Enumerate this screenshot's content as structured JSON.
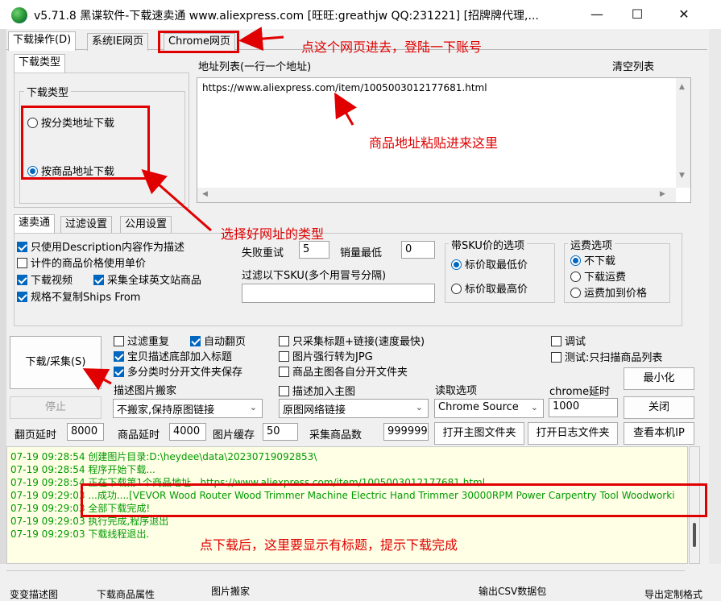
{
  "window": {
    "title": "v5.71.8  黑谍软件-下载速卖通  www.aliexpress.com [旺旺:greathjw QQ:231221] [招牌牌代理,..."
  },
  "tabs": [
    "下载操作(D)",
    "系统IE网页",
    "Chrome网页"
  ],
  "download_type": {
    "tab": "下载类型",
    "group_title": "下载类型",
    "options": [
      "按分类地址下载",
      "按商品地址下载"
    ],
    "selected": 1
  },
  "address": {
    "label": "地址列表(一行一个地址)",
    "clear_label": "清空列表",
    "value": "https://www.aliexpress.com/item/1005003012177681.html"
  },
  "settings_tabs": [
    "速卖通",
    "过滤设置",
    "公用设置"
  ],
  "checkboxes_left": [
    {
      "label": "只使用Description内容作为描述",
      "checked": true
    },
    {
      "label": "计件的商品价格使用单价",
      "checked": false
    },
    {
      "label": "下载视频",
      "checked": true
    },
    {
      "label": "采集全球英文站商品",
      "checked": true
    },
    {
      "label": "规格不复制Ships From",
      "checked": true
    }
  ],
  "retry": {
    "label": "失败重试",
    "value": "5"
  },
  "min_sales": {
    "label": "销量最低",
    "value": "0"
  },
  "sku_filter": {
    "label": "过滤以下SKU(多个用冒号分隔)",
    "value": ""
  },
  "sku_price": {
    "title": "带SKU价的选项",
    "options": [
      "标价取最低价",
      "标价取最高价"
    ],
    "selected": 0
  },
  "shipping": {
    "title": "运费选项",
    "options": [
      "不下载",
      "下载运费",
      "运费加到价格"
    ],
    "selected": 0
  },
  "actions": {
    "download": "下载/采集(S)",
    "stop": "停止",
    "minimize": "最小化",
    "close": "关闭",
    "open_main_folder": "打开主图文件夹",
    "open_log_folder": "打开日志文件夹",
    "check_ip": "查看本机IP"
  },
  "options_mid": [
    {
      "label": "过滤重复",
      "checked": false
    },
    {
      "label": "自动翻页",
      "checked": true
    },
    {
      "label": "宝贝描述底部加入标题",
      "checked": true
    },
    {
      "label": "多分类时分开文件夹保存",
      "checked": true
    },
    {
      "label": "描述加入主图",
      "checked": false
    }
  ],
  "options_right": [
    {
      "label": "只采集标题+链接(速度最快)",
      "checked": false
    },
    {
      "label": "图片强行转为JPG",
      "checked": false
    },
    {
      "label": "商品主图各自分开文件夹",
      "checked": false
    }
  ],
  "options_far": [
    {
      "label": "调试",
      "checked": false
    },
    {
      "label": "测试:只扫描商品列表",
      "checked": false
    }
  ],
  "desc_image": {
    "label": "描述图片搬家",
    "value": "不搬家,保持原图链接"
  },
  "main_image": {
    "value": "原图网络链接"
  },
  "read_option": {
    "label": "读取选项",
    "value": "Chrome Source"
  },
  "chrome_delay": {
    "label": "chrome延时",
    "value": "1000"
  },
  "delays": {
    "page_label": "翻页延时",
    "page_value": "8000",
    "item_label": "商品延时",
    "item_value": "4000",
    "cache_label": "图片缓存",
    "cache_value": "50",
    "count_label": "采集商品数",
    "count_value": "999999"
  },
  "log": [
    "07-19 09:28:54  创建图片目录:D:\\heydee\\data\\20230719092853\\",
    "07-19 09:28:54  程序开始下载...",
    "07-19 09:28:54  正在下载第1个商品地址...https://www.aliexpress.com/item/1005003012177681.html",
    "07-19 09:29:03  ...成功....[VEVOR Wood Router Wood Trimmer Machine Electric Hand Trimmer 30000RPM Power Carpentry Tool Woodworki",
    "07-19 09:29:03  全部下载完成!",
    "07-19 09:29:03  执行完成,程序退出",
    "07-19 09:29:03  下载线程退出."
  ],
  "annotations": {
    "chrome_tab": "点这个网页进去，登陆一下账号",
    "address": "商品地址粘贴进来这里",
    "type": "选择好网址的类型",
    "result": "点下载后，这里要显示有标题，提示下载完成"
  },
  "bottom_partial": [
    "变变描述图",
    "下载商品属性",
    "图片搬家",
    "输出CSV数据包",
    "导出定制格式"
  ],
  "colors": {
    "annotation": "#e00000",
    "log_text": "#009a00",
    "log_bg": "#ffffe6",
    "accent": "#0067c0"
  }
}
